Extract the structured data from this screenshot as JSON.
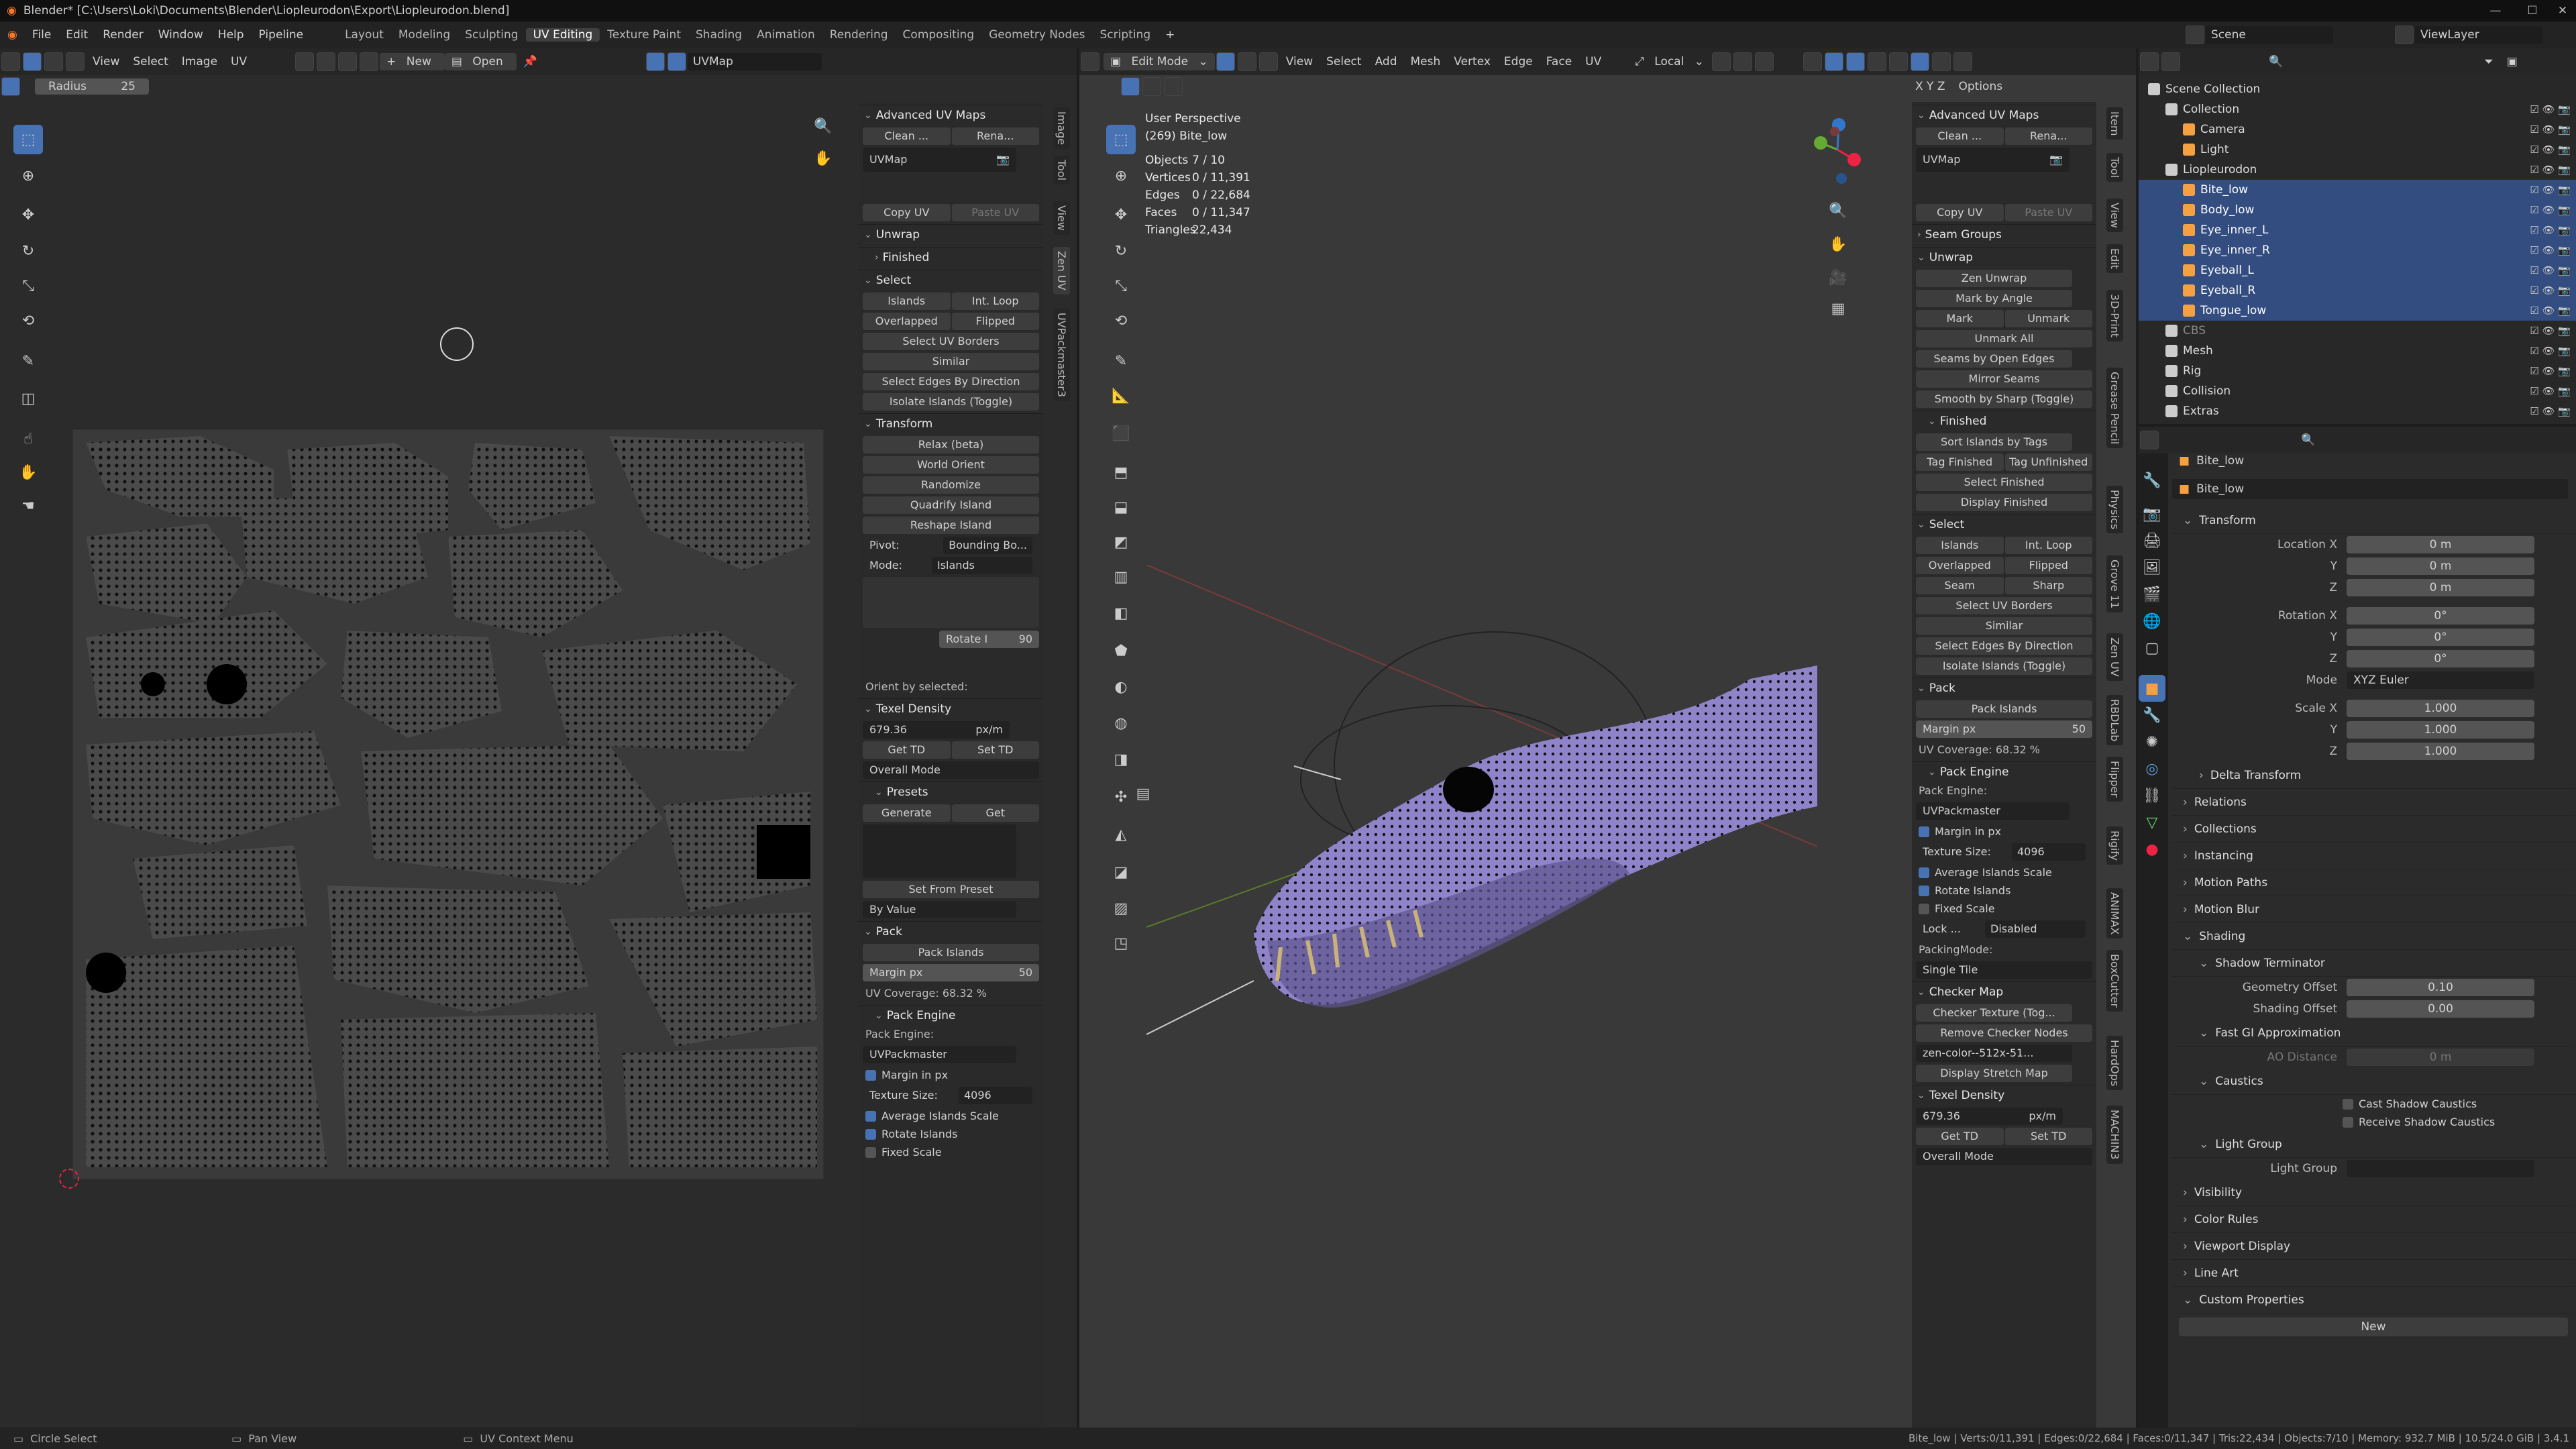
{
  "title": {
    "text": "Blender* [C:\\Users\\Loki\\Documents\\Blender\\Liopleurodon\\Export\\Liopleurodon.blend]"
  },
  "menu": [
    "File",
    "Edit",
    "Render",
    "Window",
    "Help",
    "Pipeline"
  ],
  "workspaces": [
    "Layout",
    "Modeling",
    "Sculpting",
    "UV Editing",
    "Texture Paint",
    "Shading",
    "Animation",
    "Rendering",
    "Compositing",
    "Geometry Nodes",
    "Scripting"
  ],
  "active_workspace": "UV Editing",
  "scene": {
    "label": "Scene",
    "viewlayer": "ViewLayer"
  },
  "uv_header": {
    "menus": [
      "View",
      "Select",
      "Image",
      "UV"
    ],
    "new": "New",
    "open": "Open",
    "uvmap": "UVMap",
    "radius_label": "Radius",
    "radius_value": "25"
  },
  "uv_npanel": {
    "title": "Advanced UV Maps",
    "clean": "Clean ...",
    "rename": "Rena...",
    "uvmap": "UVMap",
    "copy": "Copy UV",
    "paste": "Paste UV",
    "unwrap": "Unwrap",
    "finished": "Finished",
    "select": "Select",
    "islands": "Islands",
    "intloop": "Int. Loop",
    "overlapped": "Overlapped",
    "flipped": "Flipped",
    "sel_borders": "Select UV Borders",
    "similar": "Similar",
    "edges_dir": "Select Edges By Direction",
    "isolate": "Isolate Islands (Toggle)",
    "transform": "Transform",
    "relax": "Relax (beta)",
    "world": "World Orient",
    "randomize": "Randomize",
    "quadrify": "Quadrify Island",
    "reshape": "Reshape Island",
    "pivot_l": "Pivot:",
    "pivot_v": "Bounding Bo...",
    "mode_l": "Mode:",
    "mode_v": "Islands",
    "rotate": "Rotate I",
    "rotate_v": "90",
    "orient": "Orient by selected:",
    "td": "Texel Density",
    "td_v": "679.36",
    "td_u": "px/m",
    "get": "Get TD",
    "set": "Set TD",
    "overall": "Overall Mode",
    "presets": "Presets",
    "generate": "Generate",
    "getp": "Get",
    "setfrom": "Set From Preset",
    "byval": "By Value",
    "pack": "Pack",
    "packisl": "Pack Islands",
    "margin": "Margin px",
    "margin_v": "50",
    "cov": "UV Coverage: 68.32 %",
    "engine": "Pack Engine",
    "engine_l": "Pack Engine:",
    "engine_v": "UVPackmaster",
    "margininpx": "Margin in px",
    "tex_l": "Texture Size:",
    "tex_v": "4096",
    "avg": "Average Islands Scale",
    "rot": "Rotate Islands",
    "fixed": "Fixed Scale"
  },
  "vtabs_uv": [
    "Image",
    "Tool",
    "View",
    "Zen UV",
    "UVPackmaster3"
  ],
  "vp_header": {
    "mode": "Edit Mode",
    "menus": [
      "View",
      "Select",
      "Add",
      "Mesh",
      "Vertex",
      "Edge",
      "Face",
      "UV"
    ],
    "orient": "Local",
    "options": "Options"
  },
  "vp_info": {
    "persp": "User Perspective",
    "obj": "(269) Bite_low",
    "rows": [
      [
        "Objects",
        "7 / 10"
      ],
      [
        "Vertices",
        "0 / 11,391"
      ],
      [
        "Edges",
        "0 / 22,684"
      ],
      [
        "Faces",
        "0 / 11,347"
      ],
      [
        "Triangles",
        "22,434"
      ]
    ]
  },
  "vp_npanel": {
    "title": "Advanced UV Maps",
    "clean": "Clean ...",
    "rename": "Rena...",
    "uvmap": "UVMap",
    "copy": "Copy UV",
    "paste": "Paste UV",
    "seamgroups": "Seam Groups",
    "unwrap": "Unwrap",
    "zen": "Zen Unwrap",
    "markangle": "Mark by Angle",
    "mark": "Mark",
    "unmark": "Unmark",
    "unmarkall": "Unmark All",
    "seamsopen": "Seams by Open Edges",
    "mirror": "Mirror Seams",
    "smooth": "Smooth by Sharp (Toggle)",
    "finished": "Finished",
    "sort": "Sort Islands by Tags",
    "tagf": "Tag Finished",
    "tagu": "Tag Unfinished",
    "self": "Select Finished",
    "disp": "Display Finished",
    "select": "Select",
    "islands": "Islands",
    "intloop": "Int. Loop",
    "overlapped": "Overlapped",
    "flipped": "Flipped",
    "seam": "Seam",
    "sharp": "Sharp",
    "sel_borders": "Select UV Borders",
    "similar": "Similar",
    "edges_dir": "Select Edges By Direction",
    "isolate": "Isolate Islands (Toggle)",
    "pack": "Pack",
    "packisl": "Pack Islands",
    "margin": "Margin px",
    "margin_v": "50",
    "cov": "UV Coverage: 68.32 %",
    "engine": "Pack Engine",
    "engine_l": "Pack Engine:",
    "engine_v": "UVPackmaster",
    "margininpx": "Margin in px",
    "tex_l": "Texture Size:",
    "tex_v": "4096",
    "avg": "Average Islands Scale",
    "rot": "Rotate Islands",
    "fixed": "Fixed Scale",
    "lock_l": "Lock ...",
    "lock_v": "Disabled",
    "pm_l": "PackingMode:",
    "pm_v": "Single Tile",
    "checker": "Checker Map",
    "checkertex": "Checker Texture (Tog...",
    "removenodes": "Remove Checker Nodes",
    "zencolor": "zen-color--512x-51...",
    "stretch": "Display Stretch Map",
    "td": "Texel Density",
    "td_v": "679.36",
    "td_u": "px/m",
    "get": "Get TD",
    "set": "Set TD",
    "overall": "Overall Mode"
  },
  "vtabs_vp": [
    "Item",
    "Tool",
    "View",
    "Edit",
    "3D-Print",
    "Grease Pencil",
    "Physics",
    "Grove 11",
    "Zen UV",
    "RBDLab",
    "Flipper",
    "Rigify",
    "ANIMAX",
    "BoxCutter",
    "HardOps",
    "MACHIN3"
  ],
  "outliner": {
    "rows": [
      {
        "name": "Scene Collection",
        "lvl": 0,
        "sel": false,
        "c": "#ddd"
      },
      {
        "name": "Collection",
        "lvl": 1,
        "sel": false,
        "c": "#ddd"
      },
      {
        "name": "Camera",
        "lvl": 2,
        "sel": false,
        "c": "#ddd"
      },
      {
        "name": "Light",
        "lvl": 2,
        "sel": false,
        "c": "#ddd"
      },
      {
        "name": "Liopleurodon",
        "lvl": 1,
        "sel": false,
        "c": "#ddd"
      },
      {
        "name": "Bite_low",
        "lvl": 2,
        "sel": true,
        "c": "#fff"
      },
      {
        "name": "Body_low",
        "lvl": 2,
        "sel": true,
        "c": "#fff"
      },
      {
        "name": "Eye_inner_L",
        "lvl": 2,
        "sel": true,
        "c": "#fff"
      },
      {
        "name": "Eye_inner_R",
        "lvl": 2,
        "sel": true,
        "c": "#fff"
      },
      {
        "name": "Eyeball_L",
        "lvl": 2,
        "sel": true,
        "c": "#fff"
      },
      {
        "name": "Eyeball_R",
        "lvl": 2,
        "sel": true,
        "c": "#fff"
      },
      {
        "name": "Tongue_low",
        "lvl": 2,
        "sel": true,
        "c": "#fff"
      },
      {
        "name": "CBS",
        "lvl": 1,
        "sel": false,
        "c": "#888"
      },
      {
        "name": "Mesh",
        "lvl": 1,
        "sel": false,
        "c": "#ddd"
      },
      {
        "name": "Rig",
        "lvl": 1,
        "sel": false,
        "c": "#ddd"
      },
      {
        "name": "Collision",
        "lvl": 1,
        "sel": false,
        "c": "#ddd"
      },
      {
        "name": "Extras",
        "lvl": 1,
        "sel": false,
        "c": "#ddd"
      }
    ]
  },
  "props": {
    "obj": "Bite_low",
    "obj2": "Bite_low",
    "transform": "Transform",
    "rows": [
      [
        "Location X",
        "0 m"
      ],
      [
        "Y",
        "0 m"
      ],
      [
        "Z",
        "0 m"
      ],
      [
        "Rotation X",
        "0°"
      ],
      [
        "Y",
        "0°"
      ],
      [
        "Z",
        "0°"
      ]
    ],
    "mode_l": "Mode",
    "mode_v": "XYZ Euler",
    "scale": [
      [
        "Scale X",
        "1.000"
      ],
      [
        "Y",
        "1.000"
      ],
      [
        "Z",
        "1.000"
      ]
    ],
    "sections": [
      "Delta Transform",
      "Relations",
      "Collections",
      "Instancing",
      "Motion Paths",
      "Motion Blur",
      "Shading"
    ],
    "shadow": "Shadow Terminator",
    "geo_l": "Geometry Offset",
    "geo_v": "0.10",
    "shd_l": "Shading Offset",
    "shd_v": "0.00",
    "fastgi": "Fast GI Approximation",
    "ao_l": "AO Distance",
    "ao_v": "0 m",
    "caustics": "Caustics",
    "cast": "Cast Shadow Caustics",
    "recv": "Receive Shadow Caustics",
    "lightgroup": "Light Group",
    "lg_l": "Light Group",
    "sections2": [
      "Visibility",
      "Color Rules",
      "Viewport Display",
      "Line Art",
      "Custom Properties"
    ],
    "new": "New"
  },
  "status": {
    "a": "Circle Select",
    "b": "Pan View",
    "c": "UV Context Menu",
    "right": "Bite_low | Verts:0/11,391 | Edges:0/22,684 | Faces:0/11,347 | Tris:22,434 | Objects:7/10 | Memory: 932.7 MiB | 10.5/24.0 GiB | 3.4.1"
  },
  "colors": {
    "accent": "#4772b3",
    "select": "#ff9a33",
    "mesh": "#8f83c9"
  }
}
